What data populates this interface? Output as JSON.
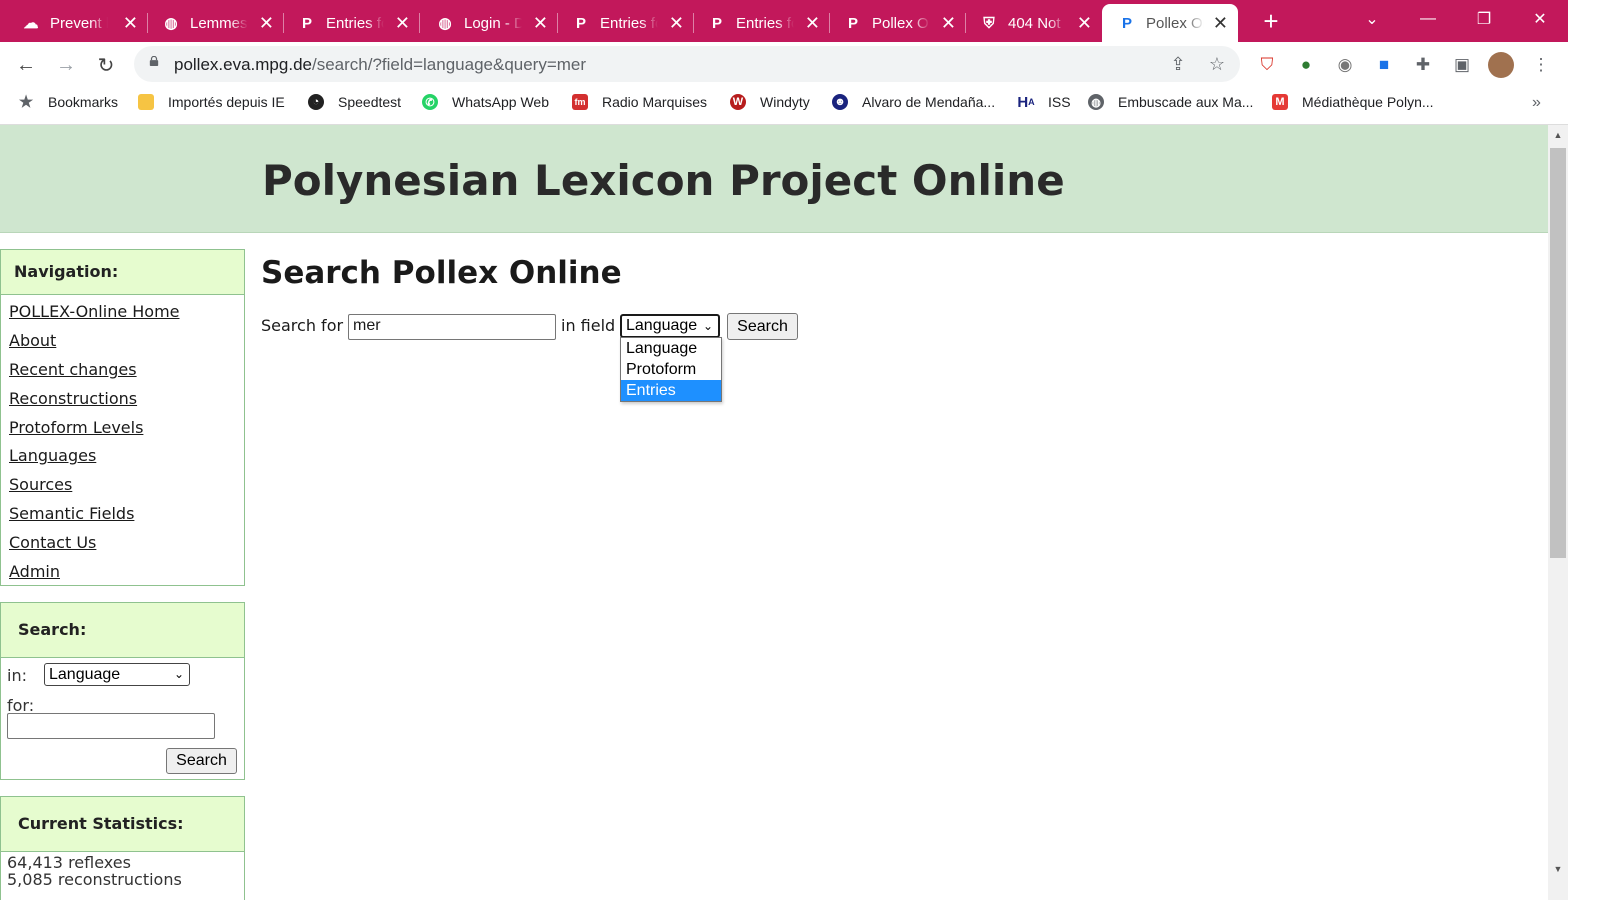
{
  "browser": {
    "tabs": [
      {
        "label": "Prevent b",
        "icon": "cloud-icon",
        "active": false
      },
      {
        "label": "Lemmes",
        "icon": "globe-icon",
        "active": false
      },
      {
        "label": "Entries fo",
        "icon": "pollex-p-icon",
        "active": false
      },
      {
        "label": "Login - D",
        "icon": "globe-icon",
        "active": false
      },
      {
        "label": "Entries fo",
        "icon": "pollex-p-icon",
        "active": false
      },
      {
        "label": "Entries fo",
        "icon": "pollex-p-icon",
        "active": false
      },
      {
        "label": "Pollex On",
        "icon": "pollex-p-icon",
        "active": false
      },
      {
        "label": "404 Not",
        "icon": "shield-crest-icon",
        "active": false
      },
      {
        "label": "Pollex On",
        "icon": "pollex-p-icon",
        "active": true
      }
    ],
    "url_host": "pollex.eva.mpg.de",
    "url_path": "/search/?field=language&query=mer",
    "bookmarks": [
      {
        "label": "Bookmarks",
        "icon": "star-icon"
      },
      {
        "label": "Importés depuis IE",
        "icon": "folder-icon"
      },
      {
        "label": "Speedtest",
        "icon": "speedtest-icon"
      },
      {
        "label": "WhatsApp Web",
        "icon": "whatsapp-icon"
      },
      {
        "label": "Radio Marquises",
        "icon": "radio-fm-icon"
      },
      {
        "label": "Windyty",
        "icon": "windyty-icon"
      },
      {
        "label": "Alvaro de Mendaña...",
        "icon": "person-icon"
      },
      {
        "label": "ISS",
        "icon": "ha-icon"
      },
      {
        "label": "Embuscade aux Ma...",
        "icon": "globe-icon"
      },
      {
        "label": "Médiathèque Polyn...",
        "icon": "m-icon"
      }
    ],
    "colors": {
      "tab_strip": "#c2185b",
      "banner": "#cfe6cf",
      "box_header": "#e6fccf",
      "selected_option": "#1e90ff"
    }
  },
  "site": {
    "title": "Polynesian Lexicon Project Online"
  },
  "nav": {
    "heading": "Navigation:",
    "links": [
      "POLLEX-Online Home",
      "About",
      "Recent changes",
      "Reconstructions",
      "Protoform Levels",
      "Languages",
      "Sources",
      "Semantic Fields",
      "Contact Us",
      "Admin"
    ]
  },
  "side_search": {
    "heading": "Search:",
    "in_label": "in:",
    "field_value": "Language",
    "for_label": "for:",
    "query_value": "",
    "button": "Search"
  },
  "stats": {
    "heading": "Current Statistics:",
    "lines": [
      "64,413 reflexes",
      "5,085 reconstructions"
    ]
  },
  "main": {
    "title": "Search Pollex Online",
    "search_for_label": "Search for",
    "query_value": "mer",
    "in_field_label": "in field",
    "field_value": "Language",
    "button": "Search",
    "options": [
      "Language",
      "Protoform",
      "Entries"
    ],
    "highlighted_option": "Entries"
  }
}
